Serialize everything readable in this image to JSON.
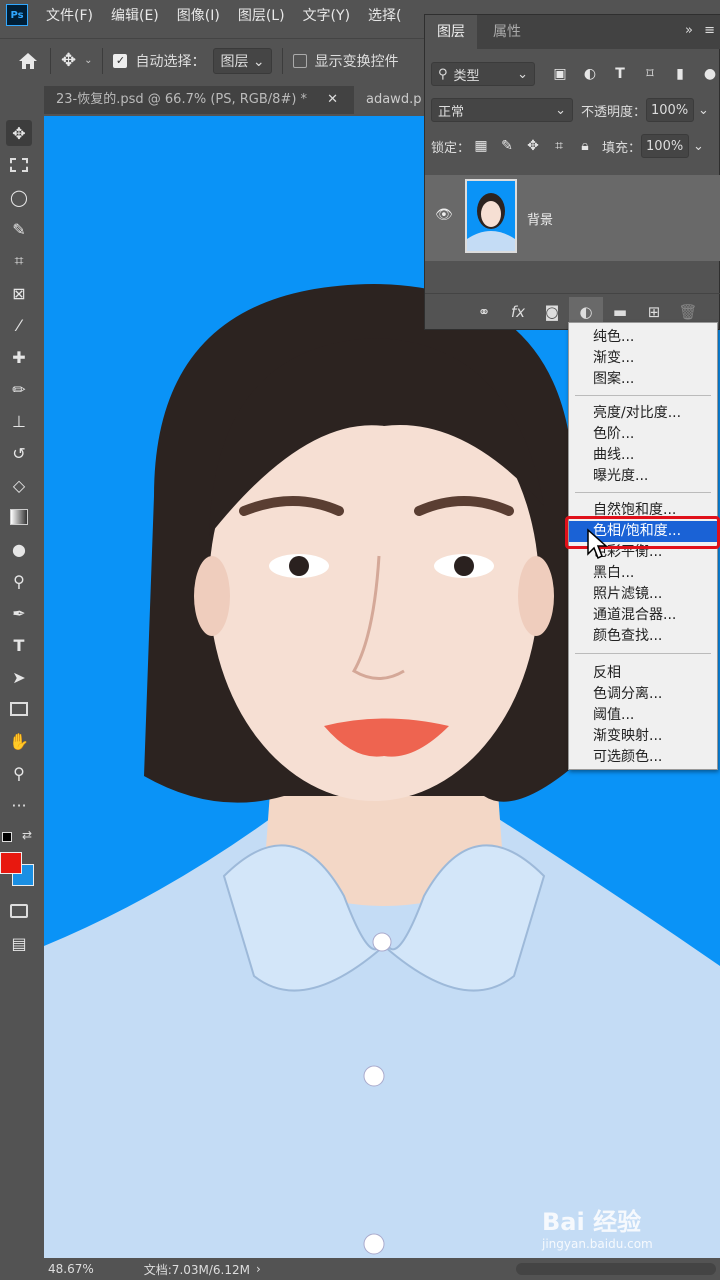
{
  "menubar": {
    "logo": "Ps",
    "items": [
      "文件(F)",
      "编辑(E)",
      "图像(I)",
      "图层(L)",
      "文字(Y)",
      "选择("
    ]
  },
  "options": {
    "auto_select_label": "自动选择：",
    "auto_select_value": "图层",
    "show_transform_label": "显示变换控件"
  },
  "tabs": [
    {
      "label": "23-恢复的.psd @ 66.7% (PS, RGB/8#) *"
    },
    {
      "label": "adawd.p"
    }
  ],
  "layers_panel": {
    "tabs": [
      "图层",
      "属性"
    ],
    "filter_label": "类型",
    "blend_mode": "正常",
    "opacity_label": "不透明度：",
    "opacity_value": "100%",
    "lock_label": "锁定：",
    "fill_label": "填充：",
    "fill_value": "100%",
    "layer_name": "背景"
  },
  "adjust_menu": {
    "items": [
      "纯色...",
      "渐变...",
      "图案...",
      "亮度/对比度...",
      "色阶...",
      "曲线...",
      "曝光度...",
      "自然饱和度...",
      "色相/饱和度...",
      "色彩平衡...",
      "黑白...",
      "照片滤镜...",
      "通道混合器...",
      "颜色查找...",
      "反相",
      "色调分离...",
      "阈值...",
      "渐变映射...",
      "可选颜色..."
    ],
    "highlighted": "色相/饱和度..."
  },
  "status": {
    "zoom": "48.67%",
    "doc": "文档:7.03M/6.12M"
  },
  "watermark": {
    "brand": "Bai 经验",
    "url": "jingyan.baidu.com"
  },
  "colors": {
    "foreground": "#e8180f",
    "background": "#1a8fe3",
    "canvas_bg": "#0a93f7",
    "highlight": "#e0101a"
  }
}
